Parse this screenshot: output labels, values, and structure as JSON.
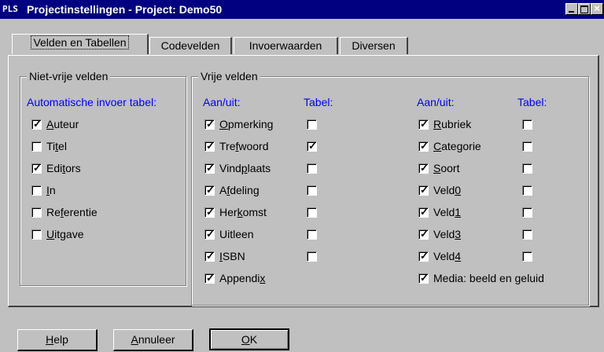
{
  "window": {
    "app_icon": "PLS",
    "title": "Projectinstellingen - Project: Demo50",
    "controls": [
      "minimize",
      "maximize",
      "close"
    ]
  },
  "tabs": [
    {
      "label": "Velden en Tabellen",
      "active": true
    },
    {
      "label": "Codevelden",
      "active": false
    },
    {
      "label": "Invoerwaarden",
      "active": false
    },
    {
      "label": "Diversen",
      "active": false
    }
  ],
  "niet_vrij": {
    "legend": "Niet-vrije velden",
    "header": "Automatische invoer tabel:",
    "items": [
      {
        "label": "Auteur",
        "ul": "A",
        "checked": true
      },
      {
        "label": "Titel",
        "ul": "t",
        "checked": false
      },
      {
        "label": "Editors",
        "ul": "t",
        "checked": true
      },
      {
        "label": "In",
        "ul": "I",
        "checked": false
      },
      {
        "label": "Referentie",
        "ul": "f",
        "checked": false
      },
      {
        "label": "Uitgave",
        "ul": "U",
        "checked": false
      }
    ]
  },
  "vrij": {
    "legend": "Vrije velden",
    "header_aanuit": "Aan/uit:",
    "header_tabel": "Tabel:",
    "col1": [
      {
        "label": "Opmerking",
        "ul": "O",
        "checked": true,
        "tabel": false
      },
      {
        "label": "Trefwoord",
        "ul": "f",
        "checked": true,
        "tabel": true
      },
      {
        "label": "Vindplaats",
        "ul": "p",
        "checked": true,
        "tabel": false
      },
      {
        "label": "Afdeling",
        "ul": "f",
        "checked": true,
        "tabel": false
      },
      {
        "label": "Herkomst",
        "ul": "k",
        "checked": true,
        "tabel": false
      },
      {
        "label": "Uitleen",
        "ul": "",
        "checked": true,
        "tabel": false
      },
      {
        "label": "ISBN",
        "ul": "I",
        "checked": true,
        "tabel": false
      },
      {
        "label": "Appendix",
        "ul": "x",
        "checked": true,
        "tabel": null
      }
    ],
    "col2": [
      {
        "label": "Rubriek",
        "ul": "R",
        "checked": true,
        "tabel": false
      },
      {
        "label": "Categorie",
        "ul": "C",
        "checked": true,
        "tabel": false
      },
      {
        "label": "Soort",
        "ul": "S",
        "checked": true,
        "tabel": false
      },
      {
        "label": "Veld0",
        "ul": "0",
        "checked": true,
        "tabel": false
      },
      {
        "label": "Veld1",
        "ul": "1",
        "checked": true,
        "tabel": false
      },
      {
        "label": "Veld3",
        "ul": "3",
        "checked": true,
        "tabel": false
      },
      {
        "label": "Veld4",
        "ul": "4",
        "checked": true,
        "tabel": false
      },
      {
        "label": "Media: beeld en geluid",
        "ul": "",
        "checked": true,
        "tabel": null
      }
    ]
  },
  "buttons": {
    "help": {
      "label": "Help",
      "ul": "H"
    },
    "annuleer": {
      "label": "Annuleer",
      "ul": "A"
    },
    "ok": {
      "label": "OK",
      "ul": "O"
    }
  }
}
